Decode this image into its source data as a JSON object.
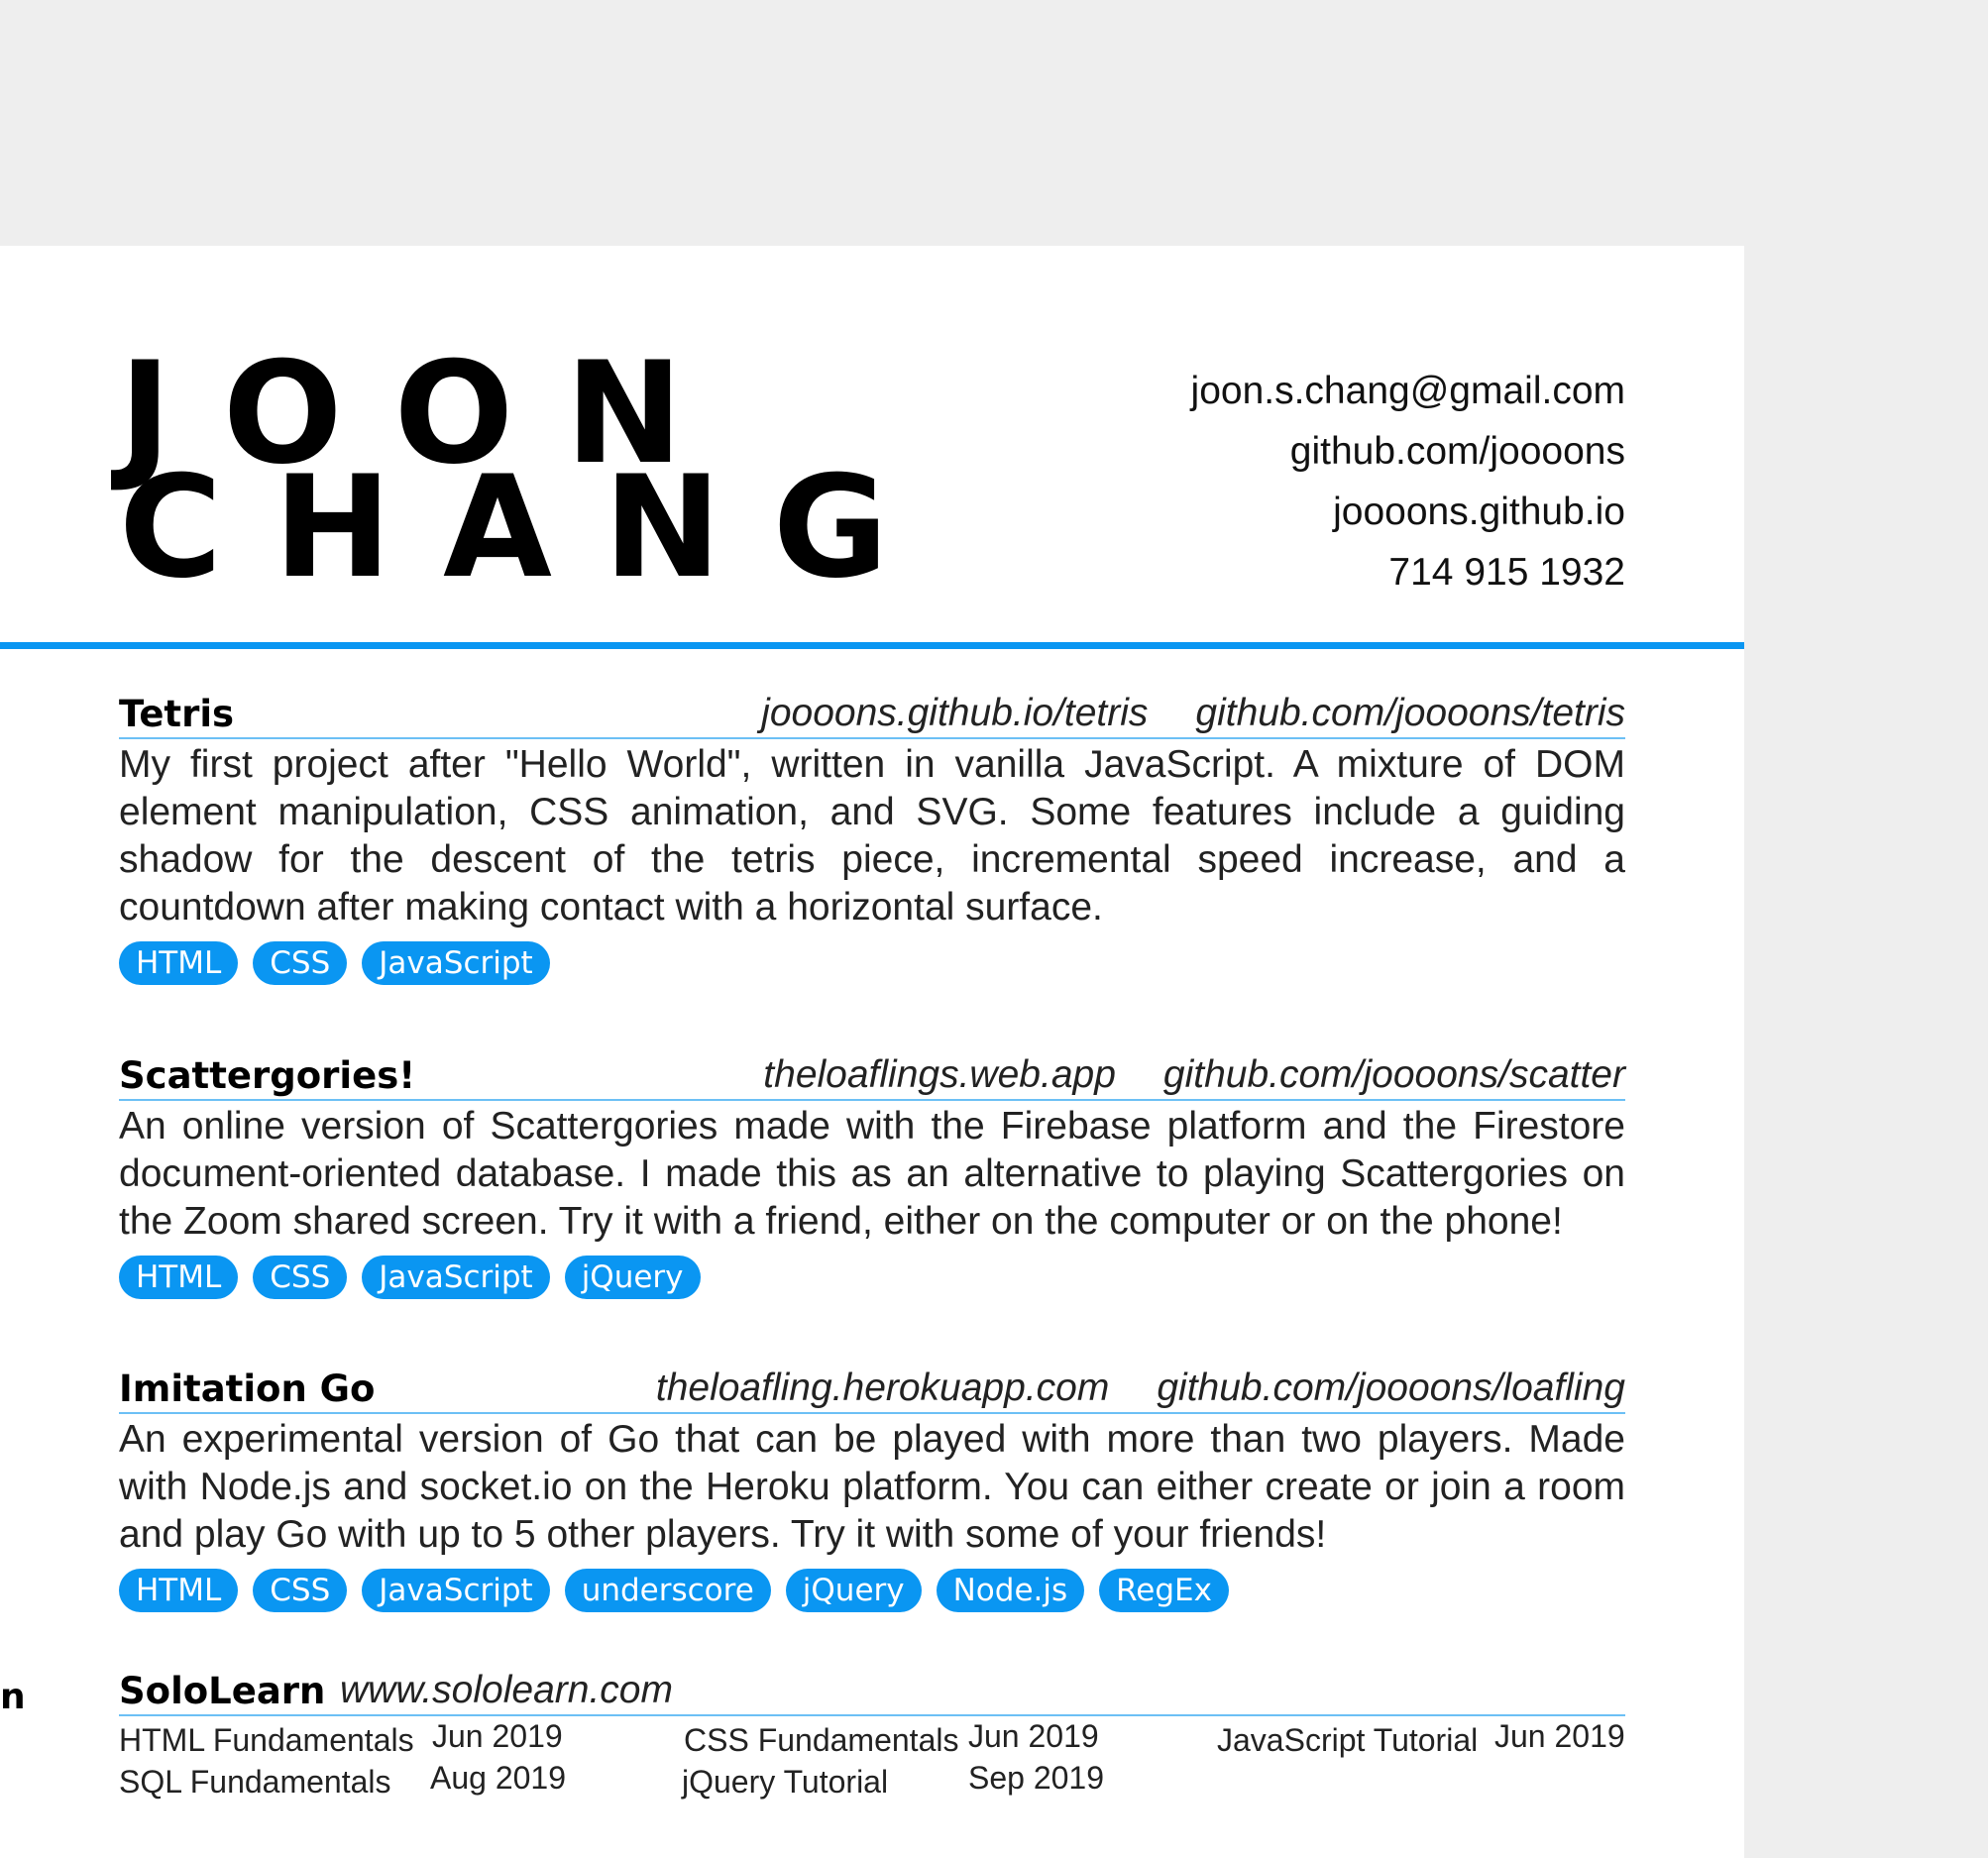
{
  "header": {
    "name_line1": "JOON",
    "name_line2": "CHANG",
    "contact": {
      "email": "joon.s.chang@gmail.com",
      "github": "github.com/joooons",
      "site": "joooons.github.io",
      "phone": "714 915 1932"
    }
  },
  "projects": [
    {
      "title": "Tetris",
      "link_live": "joooons.github.io/tetris",
      "link_repo": "github.com/joooons/tetris",
      "description": "My first project after \"Hello World\", written in vanilla JavaScript. A mixture of DOM element manipulation, CSS animation, and SVG. Some features include a guiding shadow for the descent of the tetris piece, incremental speed increase, and a countdown after making contact with a horizontal surface.",
      "tags": [
        "HTML",
        "CSS",
        "JavaScript"
      ]
    },
    {
      "title": "Scattergories!",
      "link_live": "theloaflings.web.app",
      "link_repo": "github.com/joooons/scatter",
      "description": "An online version of Scattergories made with the Firebase platform and the Firestore document-oriented database. I made this as an alternative to playing Scattergories on the Zoom shared screen. Try it with a friend, either on the computer or on the phone!",
      "tags": [
        "HTML",
        "CSS",
        "JavaScript",
        "jQuery"
      ]
    },
    {
      "title": "Imitation Go",
      "link_live": "theloafling.herokuapp.com",
      "link_repo": "github.com/joooons/loafling",
      "description": "An experimental version of Go that can be played with more than two players. Made with Node.js and socket.io on the Heroku platform. You can either create or join a room and play Go with up to 5 other players. Try it with some of your friends!",
      "tags": [
        "HTML",
        "CSS",
        "JavaScript",
        "underscore",
        "jQuery",
        "Node.js",
        "RegEx"
      ]
    }
  ],
  "side_fragment": "n",
  "sololearn": {
    "title": "SoloLearn",
    "link": "www.sololearn.com",
    "courses": [
      {
        "name": "HTML Fundamentals",
        "date": "Jun 2019"
      },
      {
        "name": "CSS Fundamentals",
        "date": "Jun 2019"
      },
      {
        "name": "JavaScript Tutorial",
        "date": "Jun 2019"
      },
      {
        "name": "SQL Fundamentals",
        "date": "Aug 2019"
      },
      {
        "name": "jQuery Tutorial",
        "date": "Sep 2019"
      }
    ]
  },
  "colors": {
    "accent": "#0a96f2",
    "page_background": "#eeeeee",
    "sheet": "#ffffff"
  }
}
